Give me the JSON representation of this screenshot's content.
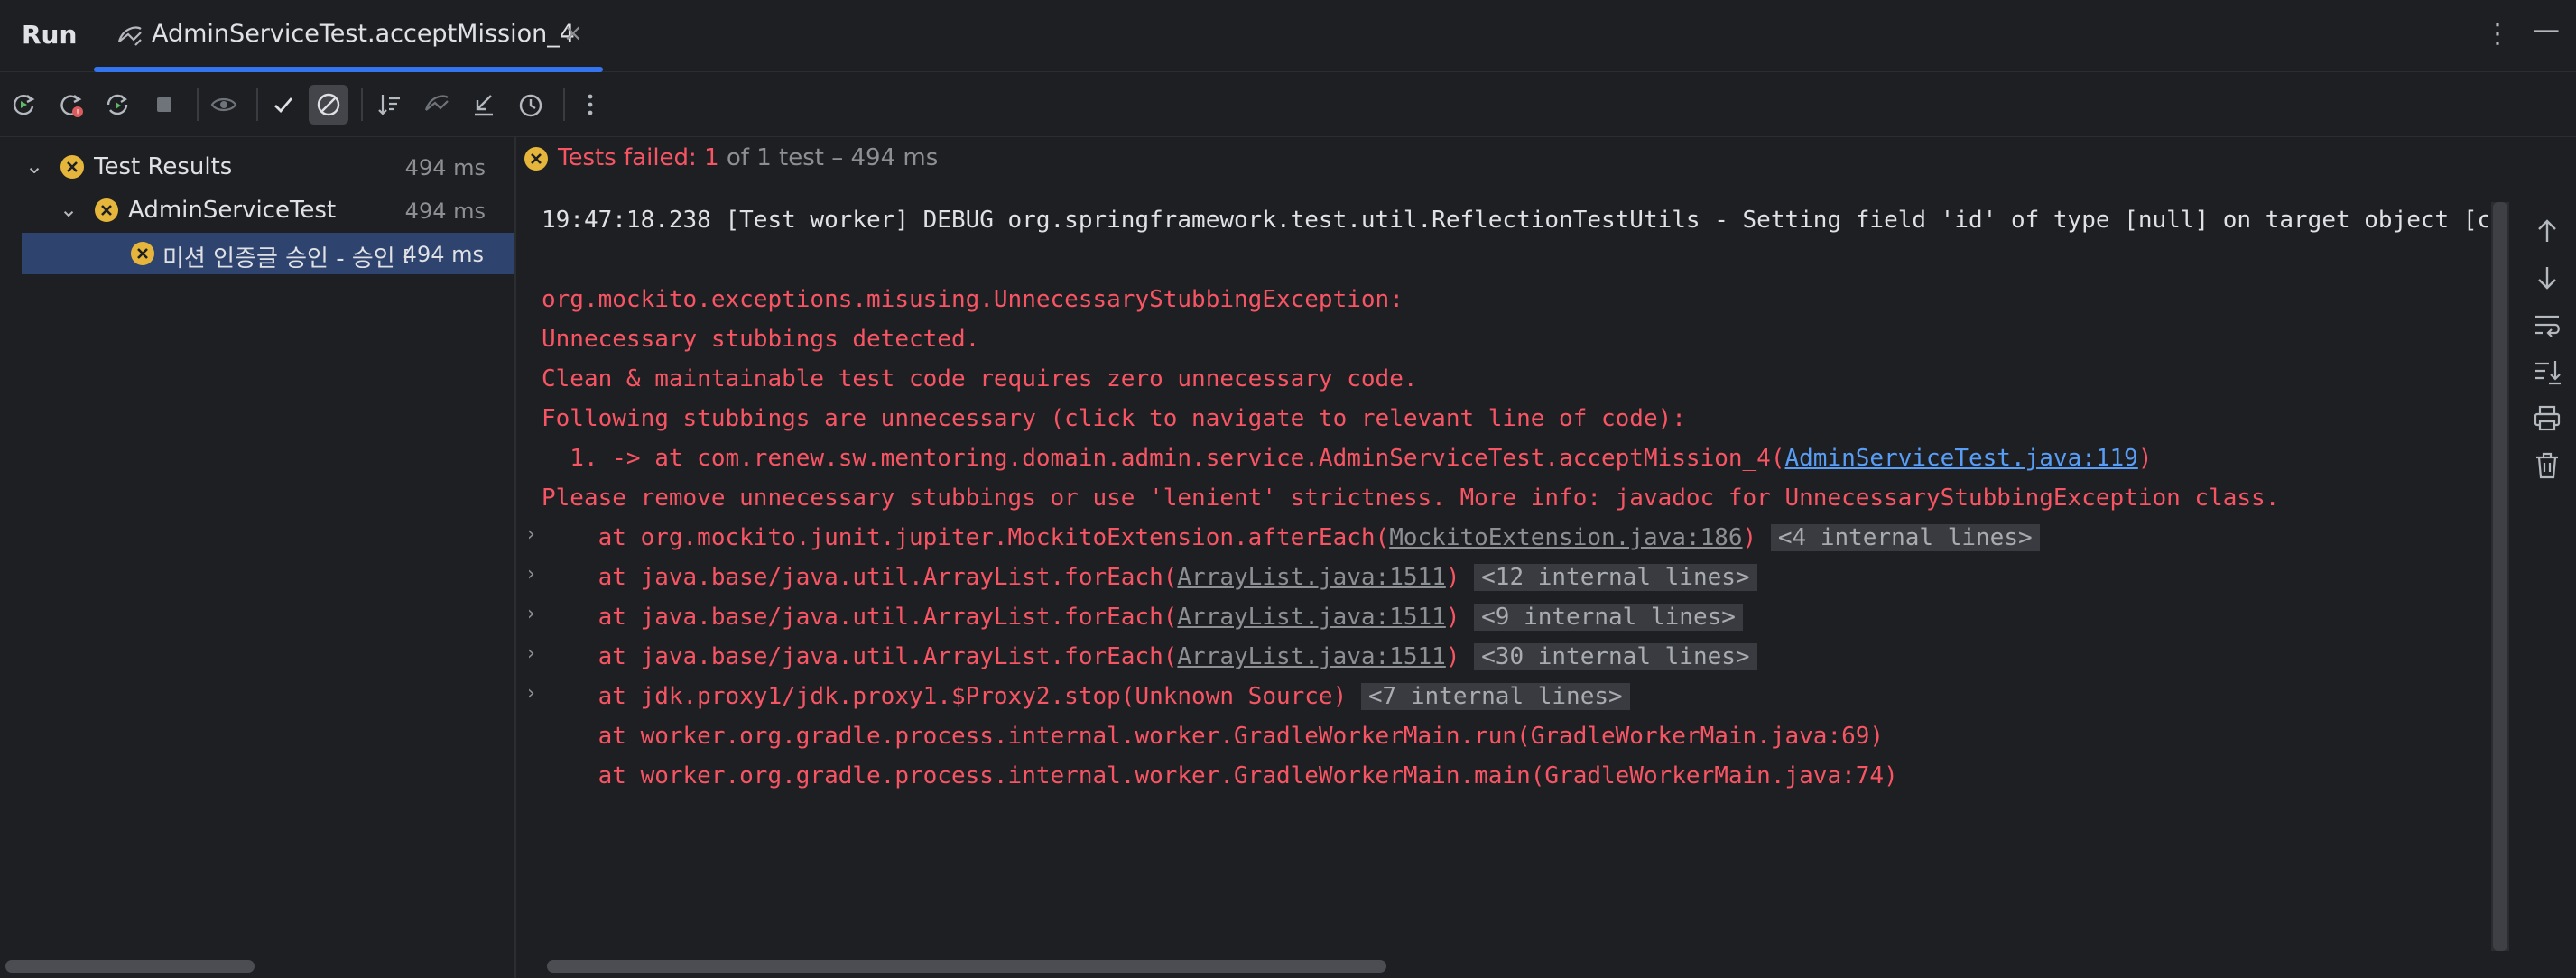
{
  "header": {
    "run_title": "Run",
    "tab_label": "AdminServiceTest.acceptMission_4",
    "tab_close": "×",
    "more": "⋮",
    "minimize": "—"
  },
  "toolbar": {
    "icons": [
      "rerun-icon",
      "rerun-failed-icon",
      "rerun-automatically-icon",
      "stop-icon",
      "show-passed-icon",
      "show-ignored-icon",
      "sort-icon",
      "import-icon",
      "export-icon",
      "history-icon",
      "more-icon"
    ]
  },
  "tree": {
    "items": [
      {
        "label": "Test Results",
        "duration": "494 ms"
      },
      {
        "label": "AdminServiceTest",
        "duration": "494 ms"
      },
      {
        "label": "미션 인증글 승인 - 승인 대",
        "duration": "494 ms"
      }
    ]
  },
  "status": {
    "failed_label": "Tests failed:",
    "failed_count": "1",
    "rest": "of 1 test – 494 ms"
  },
  "console": {
    "l0": "19:47:18.238 [Test worker] DEBUG org.springframework.test.util.ReflectionTestUtils - Setting field 'id' of type [null] on target object [c",
    "l1": "org.mockito.exceptions.misusing.UnnecessaryStubbingException: ",
    "l2": "Unnecessary stubbings detected.",
    "l3": "Clean & maintainable test code requires zero unnecessary code.",
    "l4": "Following stubbings are unnecessary (click to navigate to relevant line of code):",
    "l5a": "  1. -> at com.renew.sw.mentoring.domain.admin.service.AdminServiceTest.acceptMission_4(",
    "l5link": "AdminServiceTest.java:119",
    "l5b": ")",
    "l6": "Please remove unnecessary stubbings or use 'lenient' strictness. More info: javadoc for UnnecessaryStubbingException class.",
    "frames": [
      {
        "prefix": "    at org.mockito.junit.jupiter.MockitoExtension.afterEach(",
        "link": "MockitoExtension.java:186",
        "suffix": ")",
        "internal": "<4 internal lines>"
      },
      {
        "prefix": "    at java.base/java.util.ArrayList.forEach(",
        "link": "ArrayList.java:1511",
        "suffix": ")",
        "internal": "<12 internal lines>"
      },
      {
        "prefix": "    at java.base/java.util.ArrayList.forEach(",
        "link": "ArrayList.java:1511",
        "suffix": ")",
        "internal": "<9 internal lines>"
      },
      {
        "prefix": "    at java.base/java.util.ArrayList.forEach(",
        "link": "ArrayList.java:1511",
        "suffix": ")",
        "internal": "<30 internal lines>"
      },
      {
        "prefix": "    at jdk.proxy1/jdk.proxy1.$Proxy2.stop(Unknown Source)",
        "internal": "<7 internal lines>"
      }
    ],
    "l12": "    at worker.org.gradle.process.internal.worker.GradleWorkerMain.run(GradleWorkerMain.java:69)",
    "l13": "    at worker.org.gradle.process.internal.worker.GradleWorkerMain.main(GradleWorkerMain.java:74)",
    "expander": "›"
  },
  "colors": {
    "accent": "#3574f0",
    "error": "#f75464",
    "fail_icon": "#e5b53c",
    "link": "#589df6"
  }
}
